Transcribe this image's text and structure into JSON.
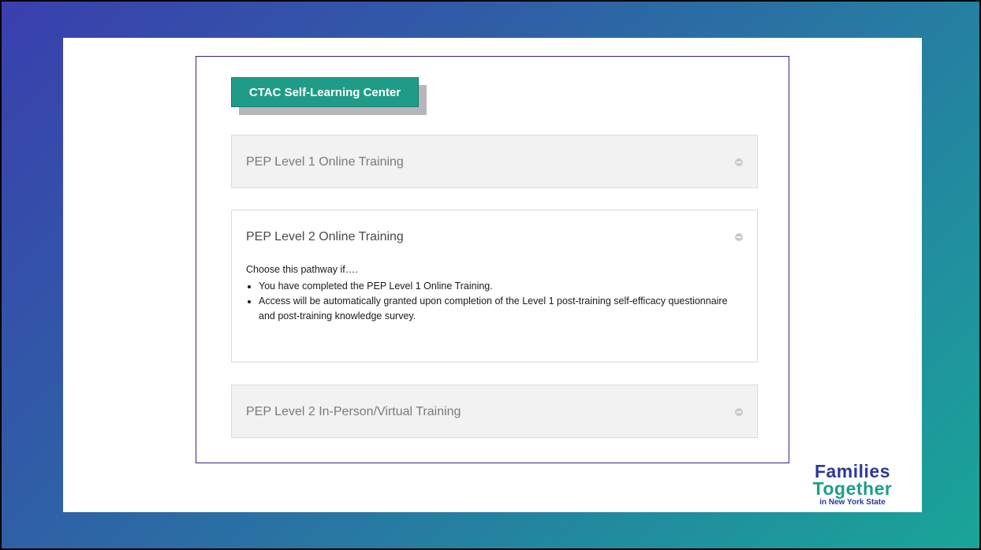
{
  "header_button": {
    "label": "CTAC Self-Learning Center"
  },
  "accordion": [
    {
      "title": "PEP Level 1 Online Training",
      "expanded": false
    },
    {
      "title": "PEP Level 2 Online Training",
      "expanded": true,
      "intro": "Choose this pathway if….",
      "bullets": [
        "You have completed the PEP Level 1 Online Training.",
        "Access will be automatically granted upon completion of the Level 1 post-training self-efficacy questionnaire and post-training knowledge survey."
      ]
    },
    {
      "title": "PEP Level 2 In-Person/Virtual Training",
      "expanded": false
    }
  ],
  "logo": {
    "line1": "Families",
    "line2": "Together",
    "line3": "in New York State"
  },
  "colors": {
    "accent_teal": "#1f9c87",
    "panel_border": "#2a2a86",
    "logo_blue": "#2b3a97",
    "logo_teal": "#1d9e8a"
  },
  "icons": {
    "accordion_toggle": "minus-circle-icon"
  }
}
